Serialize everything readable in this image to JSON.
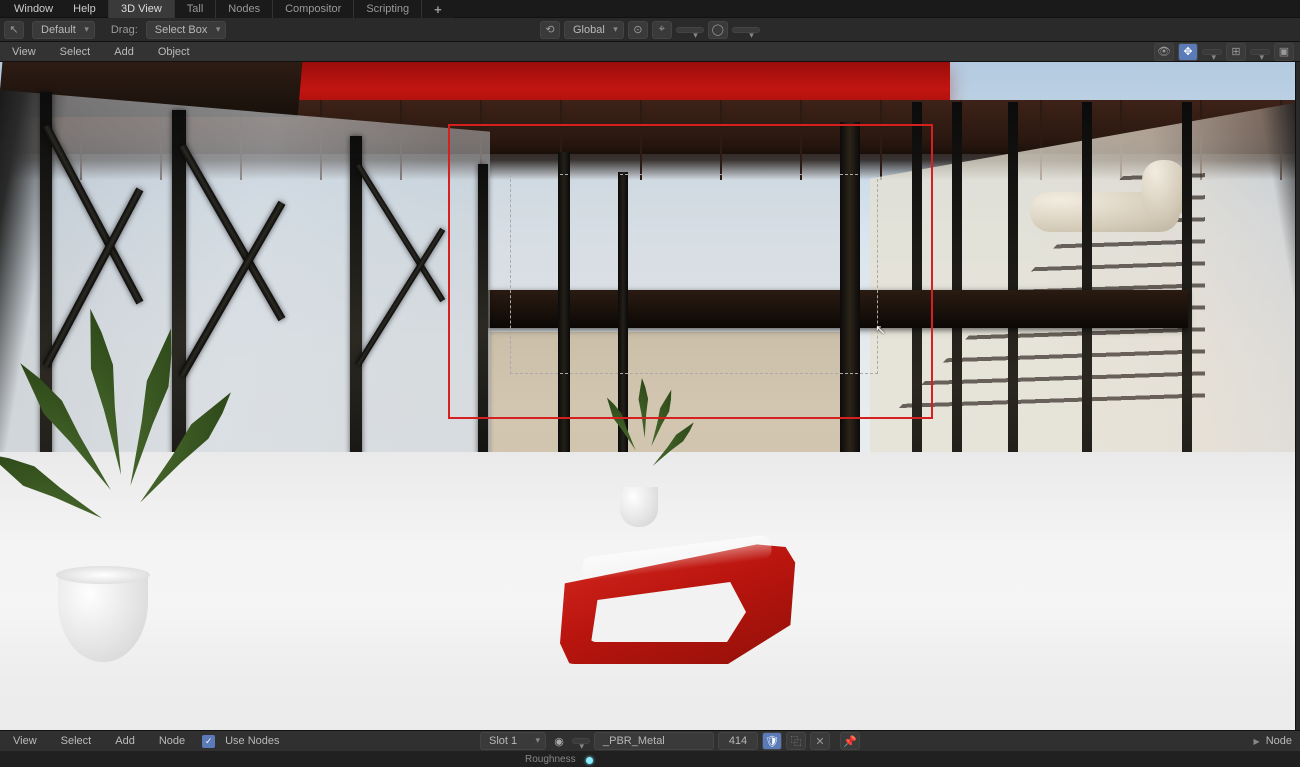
{
  "top_menu": {
    "window": "Window",
    "help": "Help"
  },
  "workspace_tabs": {
    "active": "3D View",
    "items": [
      "3D View",
      "Tall",
      "Nodes",
      "Compositor",
      "Scripting"
    ],
    "add": "+"
  },
  "tool_header": {
    "cursor_mode": "",
    "mode_dropdown": "Default",
    "drag_label": "Drag:",
    "drag_dropdown": "Select Box",
    "pivot_dropdown": "Global"
  },
  "view_header": {
    "items": [
      "View",
      "Select",
      "Add",
      "Object"
    ]
  },
  "viewport": {
    "red_box_note": "annotation rectangle",
    "render_region_note": "render region dashed"
  },
  "footer": {
    "items": [
      "View",
      "Select",
      "Add",
      "Node"
    ],
    "use_nodes_label": "Use Nodes",
    "slot_dropdown": "Slot 1",
    "material_name": "_PBR_Metal",
    "users": "414",
    "right_label": "Node"
  },
  "bottom_bar": {
    "roughness_label": "Roughness"
  }
}
